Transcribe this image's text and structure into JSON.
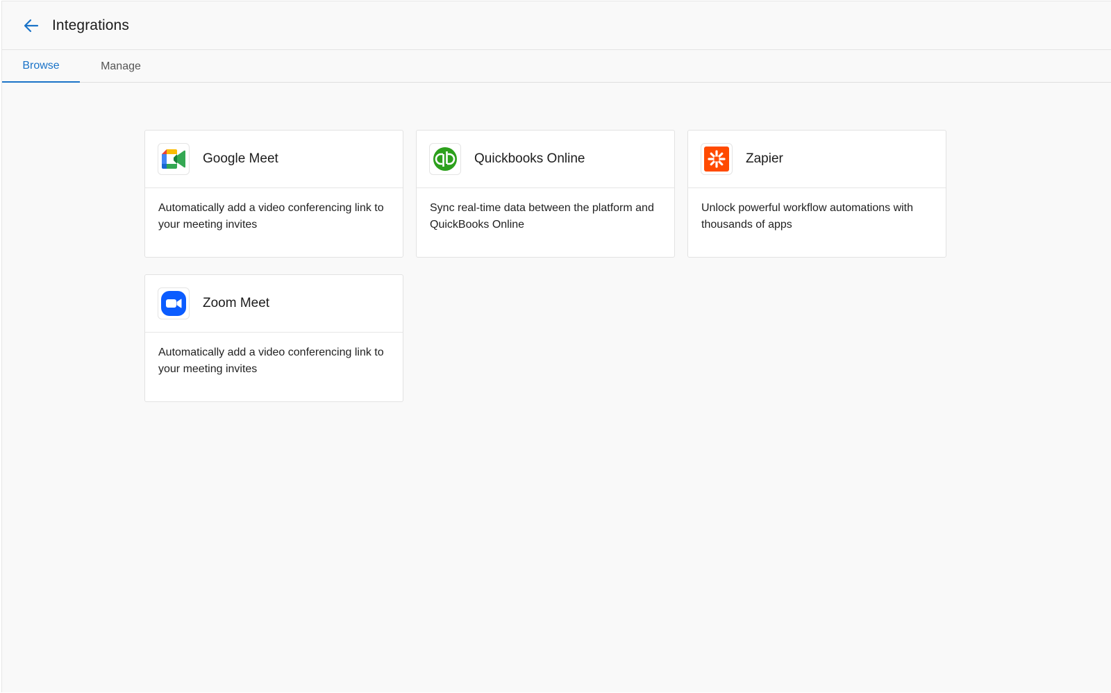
{
  "header": {
    "title": "Integrations",
    "back_icon": "arrow-left-icon"
  },
  "tabs": [
    {
      "label": "Browse",
      "active": true
    },
    {
      "label": "Manage",
      "active": false
    }
  ],
  "colors": {
    "accent": "#1a73c8",
    "quickbooks_green": "#2ca01c",
    "zapier_orange": "#ff4a00",
    "zoom_blue": "#0b5cff"
  },
  "integrations": [
    {
      "name": "Google Meet",
      "icon": "google-meet-icon",
      "description": "Automatically add a video conferencing link to your meeting invites"
    },
    {
      "name": "Quickbooks Online",
      "icon": "quickbooks-icon",
      "description": "Sync real-time data between the platform and QuickBooks Online"
    },
    {
      "name": "Zapier",
      "icon": "zapier-icon",
      "description": "Unlock powerful workflow automations with thousands of apps"
    },
    {
      "name": "Zoom Meet",
      "icon": "zoom-icon",
      "description": "Automatically add a video conferencing link to your meeting invites"
    }
  ]
}
